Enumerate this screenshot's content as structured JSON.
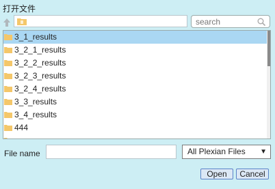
{
  "dialog": {
    "title": "打开文件"
  },
  "toolbar": {
    "search_placeholder": "search"
  },
  "files": [
    {
      "name": "3_1_results",
      "selected": true
    },
    {
      "name": "3_2_1_results",
      "selected": false
    },
    {
      "name": "3_2_2_results",
      "selected": false
    },
    {
      "name": "3_2_3_results",
      "selected": false
    },
    {
      "name": "3_2_4_results",
      "selected": false
    },
    {
      "name": "3_3_results",
      "selected": false
    },
    {
      "name": "3_4_results",
      "selected": false
    },
    {
      "name": "444",
      "selected": false
    }
  ],
  "footer": {
    "filename_label": "File name",
    "filename_value": "",
    "filetype_selected": "All Plexian Files",
    "open_label": "Open",
    "cancel_label": "Cancel"
  },
  "colors": {
    "background": "#cdeef4",
    "selection": "#aad7f3",
    "folder": "#f4c76a"
  }
}
